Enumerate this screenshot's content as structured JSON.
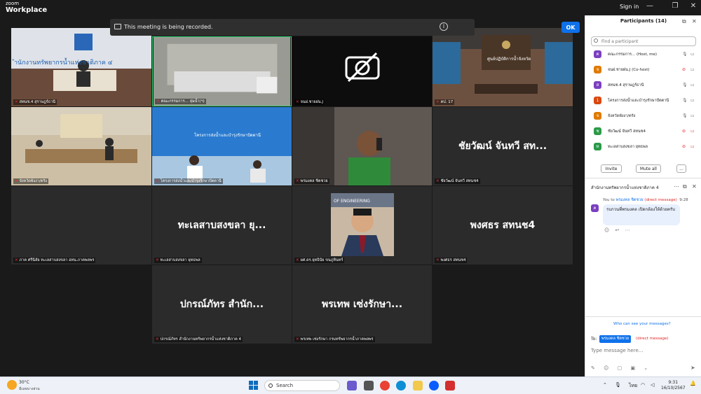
{
  "app": {
    "brand_small": "zoom",
    "brand": "Workplace",
    "sign_in": "Sign in"
  },
  "recording": {
    "message": "This meeting is being recorded.",
    "ok": "OK",
    "info_icon": "i"
  },
  "tiles": [
    {
      "name": "สทนช.4 สุราษฎร์ธานี"
    },
    {
      "name": "คณะกรรมการ... ลุ่มน้ำ(ฯ)"
    },
    {
      "name": "จนฝ.ชายฝน.J"
    },
    {
      "name": "คป. 17"
    },
    {
      "name": "จังหวัดพังงา/ตรัง"
    },
    {
      "name": "โครงการส่งน้ำและบำรุงรักษาปัตตานี"
    },
    {
      "name": "พรมงคล ชิตชวย"
    },
    {
      "name": "ชัยวัฒน์ จันทวี สทนช4",
      "big": "ชัยวัฒน์ จันทวี สท..."
    },
    {
      "name": "ภาค ศรีนิลัย ทะเลสาบสงขลา อทน.ภาคพลพร"
    },
    {
      "name": "ทะเลสาบสงขลา ยุทธพล",
      "big": "ทะเลสาบสงขลา ยุ..."
    },
    {
      "name": "ผศ.ดร.ยุทธินัย ขนภูทินทร์"
    },
    {
      "name": "พงศธร สทนช4",
      "big": "พงศธร สทนช4"
    },
    {
      "name": "ปกรณ์ภัทร สำนักงานทรัพยากรน้ำแห่งชาติภาค 4",
      "big": "ปกรณ์ภัทร สำนัก..."
    },
    {
      "name": "พรเทพ เซ่งรักษา กรมทรัพยากรน้ำภาคพลพร",
      "big": "พรเทพ เซ่งรักษา..."
    }
  ],
  "participants": {
    "title": "Participants (14)",
    "search_placeholder": "Find a participant",
    "items": [
      {
        "initial": "ค",
        "name": "คณะกรรมการ... (Host, me)",
        "color": "#7b3fbf"
      },
      {
        "initial": "จ",
        "name": "จนฝ.ชายฝน.J (Co-host)",
        "color": "#e07b00"
      },
      {
        "initial": "ส",
        "name": "สทนช.4 สุราษฎร์ธานี",
        "color": "#7b3fbf"
      },
      {
        "initial": "1",
        "name": "โครงการส่งน้ำและบำรุงรักษาปัตตานี",
        "color": "#d9480f"
      },
      {
        "initial": "จ",
        "name": "จังหวัดพังงา/ตรัง",
        "color": "#e07b00"
      },
      {
        "initial": "ช",
        "name": "ชัยวัฒน์ จันทวี สทนช4",
        "color": "#2b9a48"
      },
      {
        "initial": "ท",
        "name": "ทะเลสาบสงขลา ยุทธพล",
        "color": "#2b9a48"
      }
    ],
    "invite": "Invite",
    "mute_all": "Mute all",
    "more": "..."
  },
  "chat": {
    "title": "สำนักงานทรัพยากรน้ำแห่งชาติภาค 4",
    "you_to": "You to",
    "recipient": "พรมงคล ชิตชวย",
    "dm_label": "(direct message)",
    "time": "9:28",
    "sender_initial": "ค",
    "message": "รบกวนพี่พรมงคล เปิดกล้องให้ด้วยครับ",
    "reactions": "☺ ↩ ⋯",
    "who_can_see": "Who can see your messages?",
    "to_label": "To:",
    "placeholder": "Type message here..."
  },
  "taskbar": {
    "temp": "30°C",
    "condition": "มีเมฆบางส่วน",
    "search": "Search",
    "lang": "ไทย",
    "time": "9:31",
    "date": "16/10/2567"
  }
}
